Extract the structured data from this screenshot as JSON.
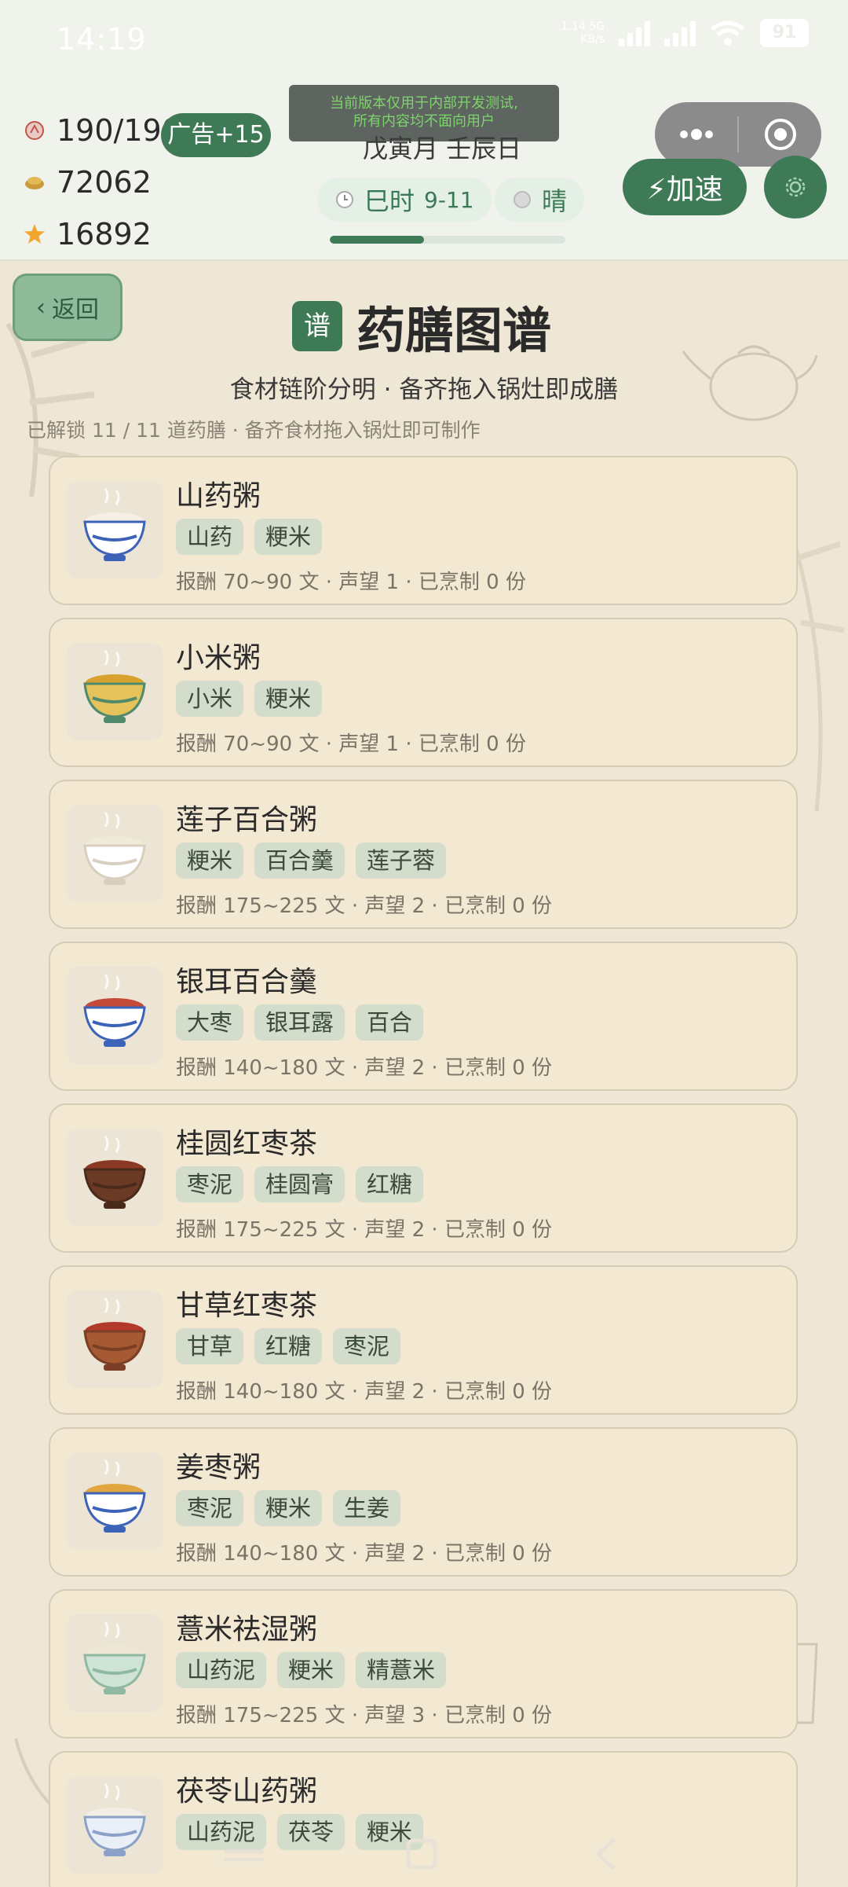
{
  "status_bar": {
    "time": "14:19",
    "net_speed": "1.14\nKB/s",
    "net_speed_l1": "1.14 5G",
    "net_speed_l2": "KB/s",
    "signal_label": "5G",
    "battery": "91"
  },
  "hud": {
    "stamina": "190/190",
    "coins": "72062",
    "stars": "16892",
    "ad_button": "广告+15",
    "notice_line1": "当前版本仅用于内部开发测试,",
    "notice_line2": "所有内容均不面向用户",
    "ganzhi": "戊寅月 壬辰日",
    "shichen": "巳时",
    "shichen_range": "9-11",
    "weather": "晴",
    "day_progress": 0.4,
    "speed_button": "⚡加速"
  },
  "page": {
    "back_label": "返回",
    "title_badge": "谱",
    "title": "药膳图谱",
    "subtitle": "食材链阶分明 · 备齐拖入锅灶即成膳",
    "unlock_info": "已解锁 11 / 11 道药膳 · 备齐食材拖入锅灶即可制作"
  },
  "recipes": [
    {
      "name": "山药粥",
      "tags": [
        "山药",
        "粳米"
      ],
      "meta": "报酬 70~90 文 · 声望 1 · 已烹制 0 份",
      "icon": "blue-porcelain-bowl-icon"
    },
    {
      "name": "小米粥",
      "tags": [
        "小米",
        "粳米"
      ],
      "meta": "报酬 70~90 文 · 声望 1 · 已烹制 0 份",
      "icon": "millet-porridge-bowl-icon"
    },
    {
      "name": "莲子百合粥",
      "tags": [
        "粳米",
        "百合羹",
        "莲子蓉"
      ],
      "meta": "报酬 175~225 文 · 声望 2 · 已烹制 0 份",
      "icon": "white-porridge-bowl-icon"
    },
    {
      "name": "银耳百合羹",
      "tags": [
        "大枣",
        "银耳露",
        "百合"
      ],
      "meta": "报酬 140~180 文 · 声望 2 · 已烹制 0 份",
      "icon": "soup-bowl-spoon-icon"
    },
    {
      "name": "桂圆红枣茶",
      "tags": [
        "枣泥",
        "桂圆膏",
        "红糖"
      ],
      "meta": "报酬 175~225 文 · 声望 2 · 已烹制 0 份",
      "icon": "tea-cup-icon"
    },
    {
      "name": "甘草红枣茶",
      "tags": [
        "甘草",
        "红糖",
        "枣泥"
      ],
      "meta": "报酬 140~180 文 · 声望 2 · 已烹制 0 份",
      "icon": "clay-cup-icon"
    },
    {
      "name": "姜枣粥",
      "tags": [
        "枣泥",
        "粳米",
        "生姜"
      ],
      "meta": "报酬 140~180 文 · 声望 2 · 已烹制 0 份",
      "icon": "ginger-porridge-bowl-icon"
    },
    {
      "name": "薏米祛湿粥",
      "tags": [
        "山药泥",
        "粳米",
        "精薏米"
      ],
      "meta": "报酬 175~225 文 · 声望 3 · 已烹制 0 份",
      "icon": "green-bowl-icon"
    },
    {
      "name": "茯苓山药粥",
      "tags": [
        "山药泥",
        "茯苓",
        "粳米"
      ],
      "meta": "",
      "icon": "porridge-bowl-spoon-icon"
    }
  ],
  "colors": {
    "accent": "#3f7a57",
    "card_bg": "#f3e8d2",
    "tag_bg": "#d4dccb",
    "page_bg": "#efe7d5"
  }
}
